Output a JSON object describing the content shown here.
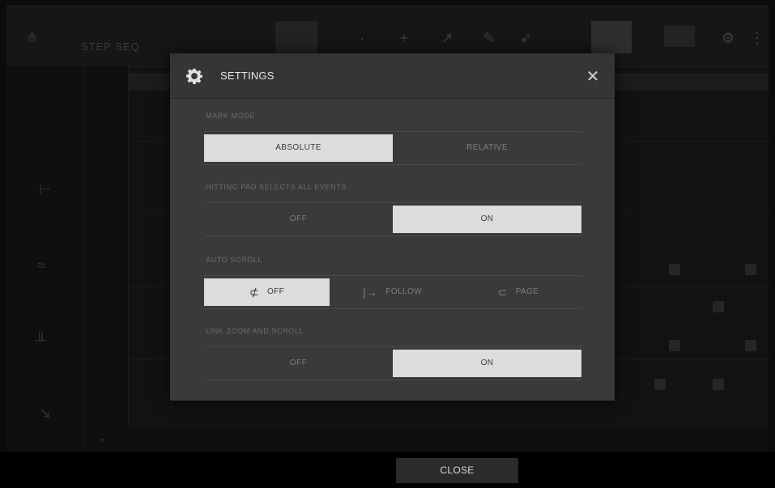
{
  "background": {
    "title": "STEP SEQ"
  },
  "dialog": {
    "title": "SETTINGS",
    "close_symbol": "✕",
    "gear_icon": "gear-icon",
    "sections": [
      {
        "label": "MARK MODE",
        "options": [
          "ABSOLUTE",
          "RELATIVE"
        ],
        "selected": "ABSOLUTE"
      },
      {
        "label": "HITTING PAD SELECTS ALL EVENTS",
        "options": [
          "OFF",
          "ON"
        ],
        "selected": "ON"
      },
      {
        "label": "AUTO SCROLL",
        "options": [
          {
            "label": "OFF",
            "icon": "scroll-off-icon",
            "glyph": "⊄"
          },
          {
            "label": "FOLLOW",
            "icon": "follow-arrow-icon",
            "glyph": "|→"
          },
          {
            "label": "PAGE",
            "icon": "page-loop-icon",
            "glyph": "⊂"
          }
        ],
        "selected": "OFF"
      },
      {
        "label": "LINK ZOOM AND SCROLL",
        "options": [
          "OFF",
          "ON"
        ],
        "selected": "ON"
      }
    ]
  },
  "footer": {
    "close_label": "CLOSE"
  },
  "colors": {
    "selected_bg": "#dcdcdc",
    "dialog_bg": "#3a3a3a",
    "page_bg": "#0b0b0b"
  }
}
